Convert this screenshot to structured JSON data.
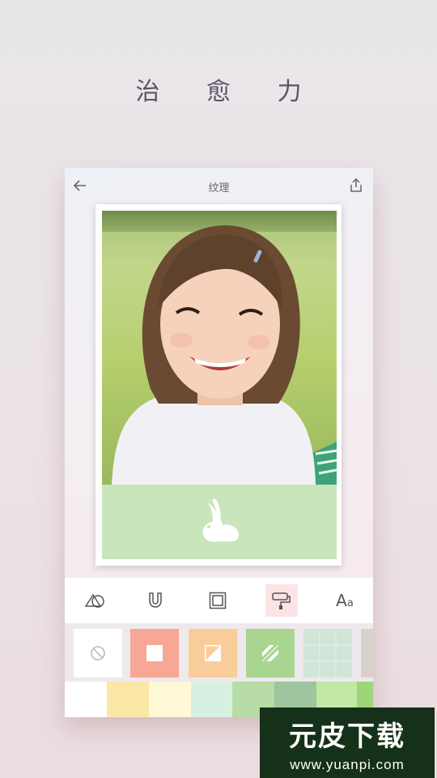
{
  "promo": {
    "title": "治 愈 力"
  },
  "header": {
    "title": "纹理"
  },
  "toolbar": {
    "tools": [
      {
        "icon": "shapes-icon"
      },
      {
        "icon": "magnet-icon"
      },
      {
        "icon": "frame-icon"
      },
      {
        "icon": "texture-roller-icon",
        "active": true
      },
      {
        "label": "A",
        "label_small": "a",
        "icon": "text-icon"
      }
    ]
  },
  "swatches": [
    {
      "icon": "none-icon",
      "color": "#ffffff"
    },
    {
      "color": "#f6a796"
    },
    {
      "color": "#f9cd9a"
    },
    {
      "color": "#a8d590"
    },
    {
      "color": "#cfe6d9"
    }
  ],
  "palette": [
    "#ffffff",
    "#fbe7a6",
    "#fef8d7",
    "#d8f0e1",
    "#b8dca5",
    "#9fc59e",
    "#c1e8a4",
    "#9dd67a"
  ],
  "watermark": {
    "main": "元皮下载",
    "url": "www.yuanpi.com"
  }
}
